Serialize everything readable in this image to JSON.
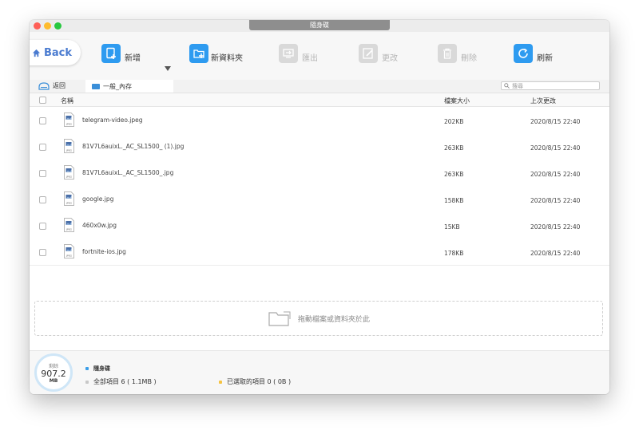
{
  "window": {
    "title": "隨身碟"
  },
  "toolbar": {
    "back_label": "Back",
    "new_label": "新增",
    "new_folder_label": "新資料夾",
    "export_label": "匯出",
    "rename_label": "更改",
    "delete_label": "刪除",
    "refresh_label": "刷新"
  },
  "pathbar": {
    "back_label": "返回",
    "current_folder": "一般_內存",
    "search_placeholder": "搜尋"
  },
  "table": {
    "col_name": "名稱",
    "col_size": "檔案大小",
    "col_modified": "上次更改",
    "rows": [
      {
        "name": "telegram-video.jpeg",
        "size": "202KB",
        "date": "2020/8/15  22:40",
        "ext": "JPEG"
      },
      {
        "name": "81V7L6auixL._AC_SL1500_ (1).jpg",
        "size": "263KB",
        "date": "2020/8/15  22:40",
        "ext": "JPEG"
      },
      {
        "name": "81V7L6auixL._AC_SL1500_.jpg",
        "size": "263KB",
        "date": "2020/8/15  22:40",
        "ext": "JPEG"
      },
      {
        "name": "google.jpg",
        "size": "158KB",
        "date": "2020/8/15  22:40",
        "ext": "JPEG"
      },
      {
        "name": "460x0w.jpg",
        "size": "15KB",
        "date": "2020/8/15  22:40",
        "ext": "JPEG"
      },
      {
        "name": "fortnite-ios.jpg",
        "size": "178KB",
        "date": "2020/8/15  22:40",
        "ext": "JPEG"
      }
    ]
  },
  "dropzone": {
    "text": "拖動檔案或資料夾於此"
  },
  "footer": {
    "gauge_label": "剩餘",
    "gauge_value": "907.2",
    "gauge_unit": "MB",
    "device_name": "隨身碟",
    "total_items": "全部項目 6 ( 1.1MB )",
    "selected_items": "已選取的項目 0 ( 0B )"
  },
  "colors": {
    "accent": "#2e9bf0",
    "back_text": "#4a7bd0",
    "device_dot": "#3b9ee8",
    "total_dot": "#c8c8c8",
    "selected_dot": "#f5c342"
  }
}
